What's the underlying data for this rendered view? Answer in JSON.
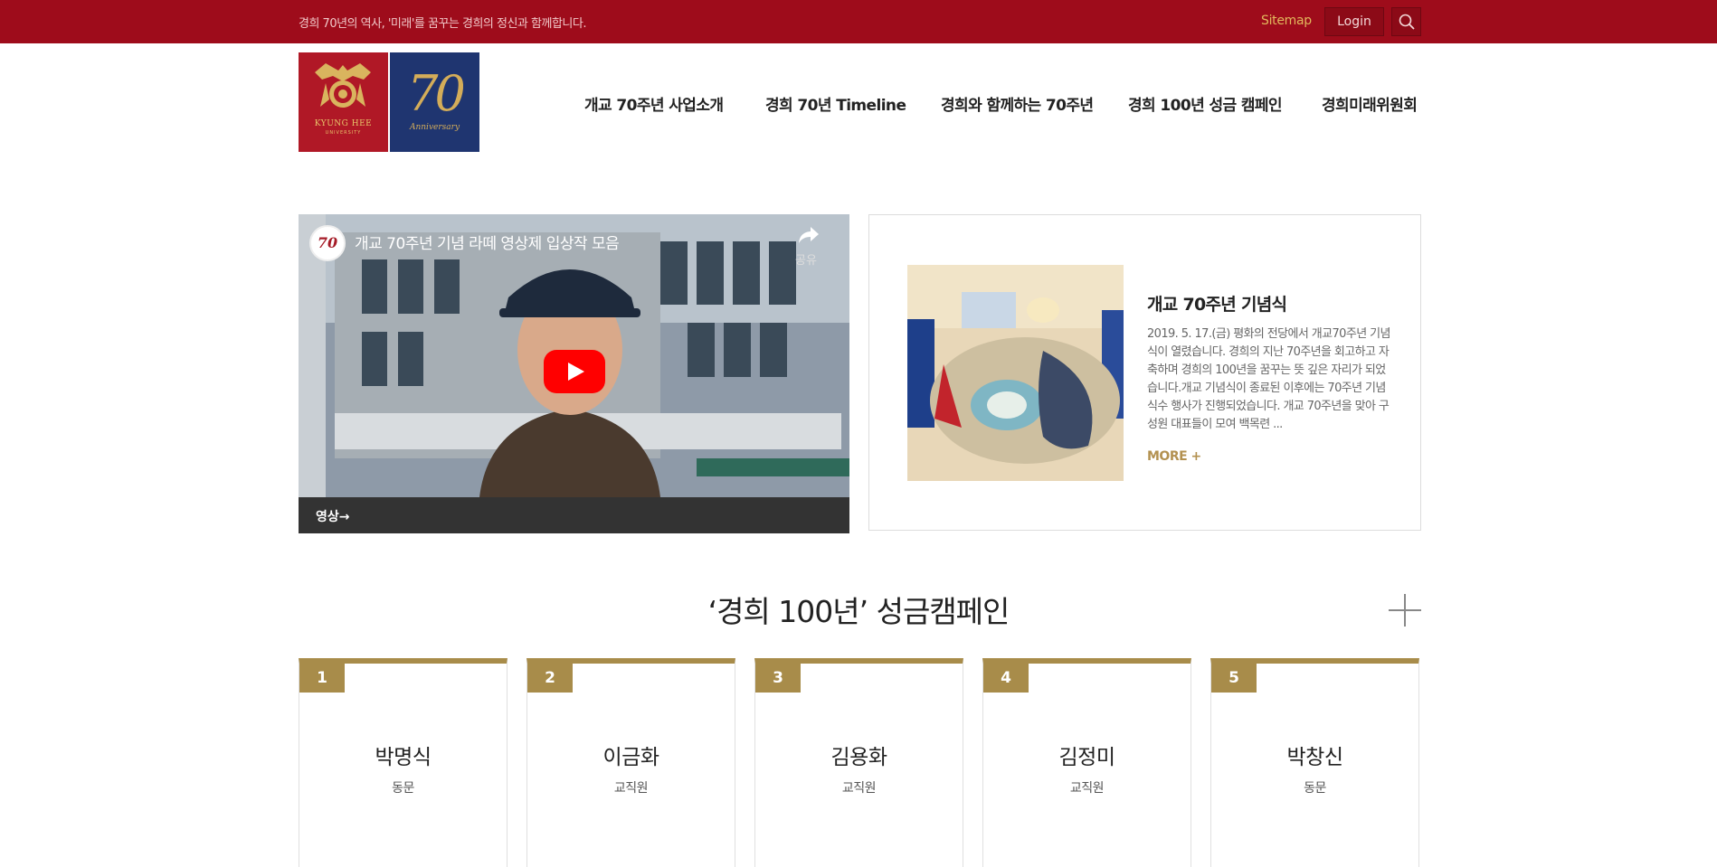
{
  "topbar": {
    "slogan": "경희 70년의 역사, '미래'를 꿈꾸는 경희의 정신과 함께합니다.",
    "sitemap": "Sitemap",
    "login": "Login"
  },
  "logo": {
    "university": "KYUNG HEE",
    "university_sub": "UNIVERSITY",
    "number": "70",
    "anniversary": "Anniversary"
  },
  "nav": [
    "개교 70주년 사업소개",
    "경희 70년 Timeline",
    "경희와 함께하는 70주년",
    "경희 100년 성금 캠페인",
    "경희미래위원회"
  ],
  "video": {
    "title": "개교 70주년 기념 라떼 영상제 입상작 모음",
    "share": "공유",
    "caption": "영상→"
  },
  "news": {
    "title": "개교 70주년 기념식",
    "description": "2019. 5. 17.(금) 평화의 전당에서 개교70주년 기념식이 열렸습니다. 경희의 지난 70주년을 회고하고 자축하며 경희의 100년을 꿈꾸는 뜻 깊은 자리가 되었습니다.개교 기념식이 종료된 이후에는 70주년 기념식수 행사가 진행되었습니다. 개교 70주년을 맞아 구성원 대표들이 모여 백목련 ...",
    "more": "MORE +"
  },
  "campaign": {
    "title": "‘경희 100년’ 성금캠페인",
    "donors": [
      {
        "rank": "1",
        "name": "박명식",
        "role": "동문"
      },
      {
        "rank": "2",
        "name": "이금화",
        "role": "교직원"
      },
      {
        "rank": "3",
        "name": "김용화",
        "role": "교직원"
      },
      {
        "rank": "4",
        "name": "김정미",
        "role": "교직원"
      },
      {
        "rank": "5",
        "name": "박창신",
        "role": "동문"
      }
    ]
  },
  "colors": {
    "topbar": "#9e0c1b",
    "gold": "#a88c4a",
    "logo_red": "#b01826",
    "logo_blue": "#1f3570"
  }
}
